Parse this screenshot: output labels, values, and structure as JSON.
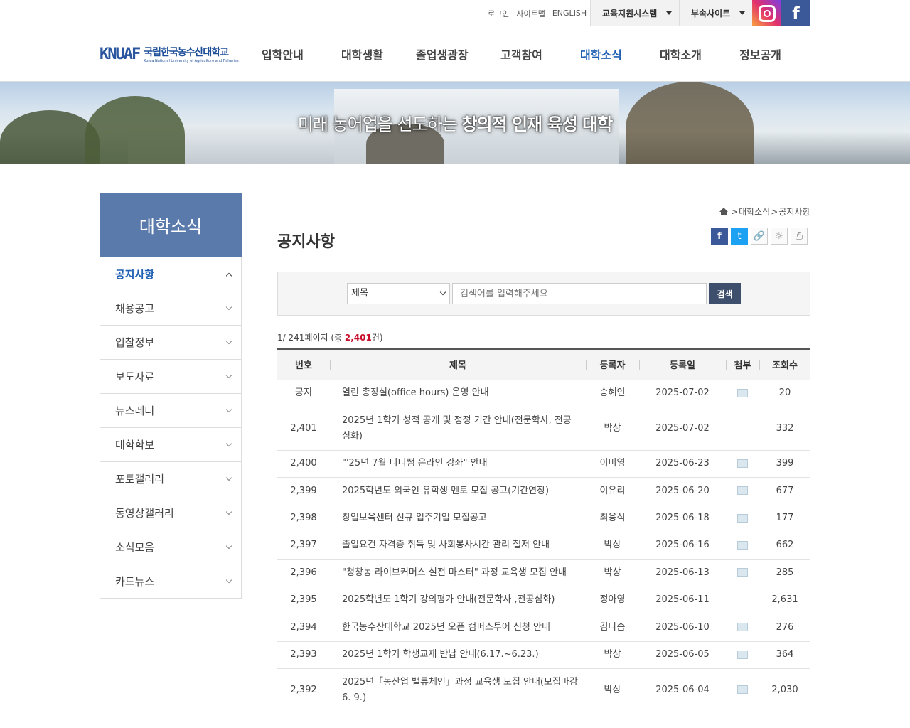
{
  "top_bar": {
    "links": [
      "로그인",
      "사이트맵",
      "ENGLISH"
    ],
    "dropdowns": [
      "교육지원시스템",
      "부속사이트"
    ],
    "sns": {
      "instagram_icon": "instagram-icon",
      "facebook_icon": "f"
    }
  },
  "header": {
    "logo_mark": "KNUAF",
    "logo_name": "국립한국농수산대학교",
    "logo_en": "Korea National University of Agriculture and Fisheries",
    "nav": [
      "입학안내",
      "대학생활",
      "졸업생광장",
      "고객참여",
      "대학소식",
      "대학소개",
      "정보공개"
    ],
    "active_nav": "대학소식"
  },
  "banner": {
    "slogan_plain": "미래 농어업을 선도하는 ",
    "slogan_bold": "창의적 인재 육성 대학"
  },
  "sidebar": {
    "title": "대학소식",
    "items": [
      "공지사항",
      "채용공고",
      "입찰정보",
      "보도자료",
      "뉴스레터",
      "대학학보",
      "포토갤러리",
      "동영상갤러리",
      "소식모음",
      "카드뉴스"
    ]
  },
  "breadcrumb": {
    "items": [
      "대학소식",
      "공지사항"
    ],
    "separator": ">"
  },
  "page_title": "공지사항",
  "share": {
    "facebook": "f",
    "twitter": "t",
    "link": "🔗",
    "metaverse": "☼",
    "print": "⎙"
  },
  "search": {
    "field_option": "제목",
    "placeholder": "검색어를 입력해주세요",
    "button": "검색"
  },
  "pagination_info": {
    "current": "1",
    "total_pages": "241",
    "prefix_pages": "페이지 (총 ",
    "total_count": "2,401",
    "suffix": "건)"
  },
  "table": {
    "headers": [
      "번호",
      "제목",
      "등록자",
      "등록일",
      "첨부",
      "조회수"
    ],
    "rows": [
      {
        "no": "공지",
        "title": "열린 총장실(office hours) 운영 안내",
        "author": "송혜인",
        "date": "2025-07-02",
        "attach": true,
        "views": "20"
      },
      {
        "no": "2,401",
        "title": "2025년 1학기 성적 공개 및 정정 기간 안내(전문학사, 전공심화)",
        "author": "박상",
        "date": "2025-07-02",
        "attach": false,
        "views": "332"
      },
      {
        "no": "2,400",
        "title": "\"'25년 7월 디디쌤 온라인 강좌\" 안내",
        "author": "이미영",
        "date": "2025-06-23",
        "attach": true,
        "views": "399"
      },
      {
        "no": "2,399",
        "title": "2025학년도 외국인 유학생 멘토 모집 공고(기간연장)",
        "author": "이유리",
        "date": "2025-06-20",
        "attach": true,
        "views": "677"
      },
      {
        "no": "2,398",
        "title": "창업보육센터 신규 입주기업 모집공고",
        "author": "최용식",
        "date": "2025-06-18",
        "attach": true,
        "views": "177"
      },
      {
        "no": "2,397",
        "title": "졸업요건 자격증 취득 및 사회봉사시간 관리 철저 안내",
        "author": "박상",
        "date": "2025-06-16",
        "attach": true,
        "views": "662"
      },
      {
        "no": "2,396",
        "title": "\"청창농 라이브커머스 실전 마스터\" 과정 교육생 모집 안내",
        "author": "박상",
        "date": "2025-06-13",
        "attach": true,
        "views": "285"
      },
      {
        "no": "2,395",
        "title": "2025학년도 1학기 강의평가 안내(전문학사 ,전공심화)",
        "author": "정아영",
        "date": "2025-06-11",
        "attach": false,
        "views": "2,631"
      },
      {
        "no": "2,394",
        "title": "한국농수산대학교 2025년 오픈 캠퍼스투어 신청 안내",
        "author": "김다솜",
        "date": "2025-06-10",
        "attach": true,
        "views": "276"
      },
      {
        "no": "2,393",
        "title": "2025년 1학기 학생교재 반납 안내(6.17.~6.23.)",
        "author": "박상",
        "date": "2025-06-05",
        "attach": true,
        "views": "364"
      },
      {
        "no": "2,392",
        "title": "2025년「농산업 밸류체인」과정 교육생 모집 안내(모집마감 6. 9.)",
        "author": "박상",
        "date": "2025-06-04",
        "attach": true,
        "views": "2,030"
      }
    ]
  }
}
